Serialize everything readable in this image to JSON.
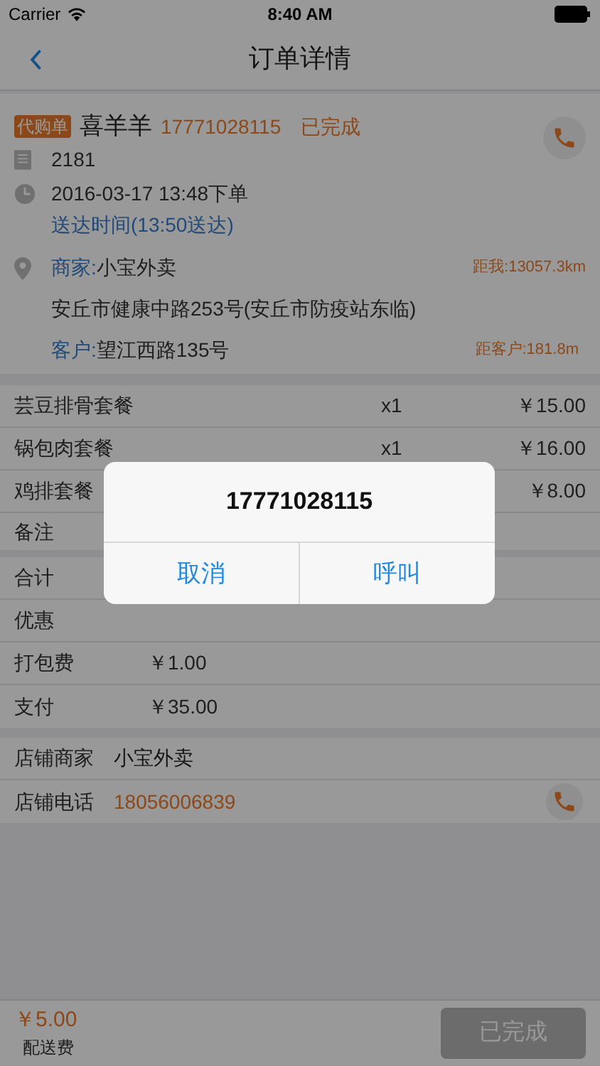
{
  "status_bar": {
    "carrier": "Carrier",
    "time": "8:40 AM"
  },
  "nav": {
    "title": "订单详情"
  },
  "order": {
    "tag": "代购单",
    "customer": "喜羊羊",
    "phone": "17771028115",
    "status": "已完成",
    "number": "2181",
    "placed": "2016-03-17 13:48下单",
    "delivered": "送达时间(13:50送达)",
    "merchant_label": "商家:",
    "merchant": "小宝外卖",
    "merchant_distance": "距我:13057.3km",
    "merchant_address": "安丘市健康中路253号(安丘市防疫站东临)",
    "customer_label": "客户:",
    "customer_address": "望江西路135号",
    "customer_distance": "距客户:181.8m"
  },
  "items": [
    {
      "name": "芸豆排骨套餐",
      "qty": "x1",
      "price": "￥15.00"
    },
    {
      "name": "锅包肉套餐",
      "qty": "x1",
      "price": "￥16.00"
    },
    {
      "name": "鸡排套餐",
      "price": "￥8.00"
    }
  ],
  "note_label": "备注",
  "totals": [
    {
      "label": "合计"
    },
    {
      "label": "优惠"
    },
    {
      "label": "打包费",
      "value": "￥1.00"
    },
    {
      "label": "支付",
      "value": "￥35.00"
    }
  ],
  "shop": [
    {
      "kind": "text",
      "label": "店铺商家",
      "value": "小宝外卖"
    },
    {
      "kind": "phone",
      "label": "店铺电话",
      "value": "18056006839"
    }
  ],
  "footer": {
    "fee": "￥5.00",
    "fee_label": "配送费",
    "button": "已完成"
  },
  "alert": {
    "title": "17771028115",
    "buttons": [
      "取消",
      "呼叫"
    ]
  }
}
